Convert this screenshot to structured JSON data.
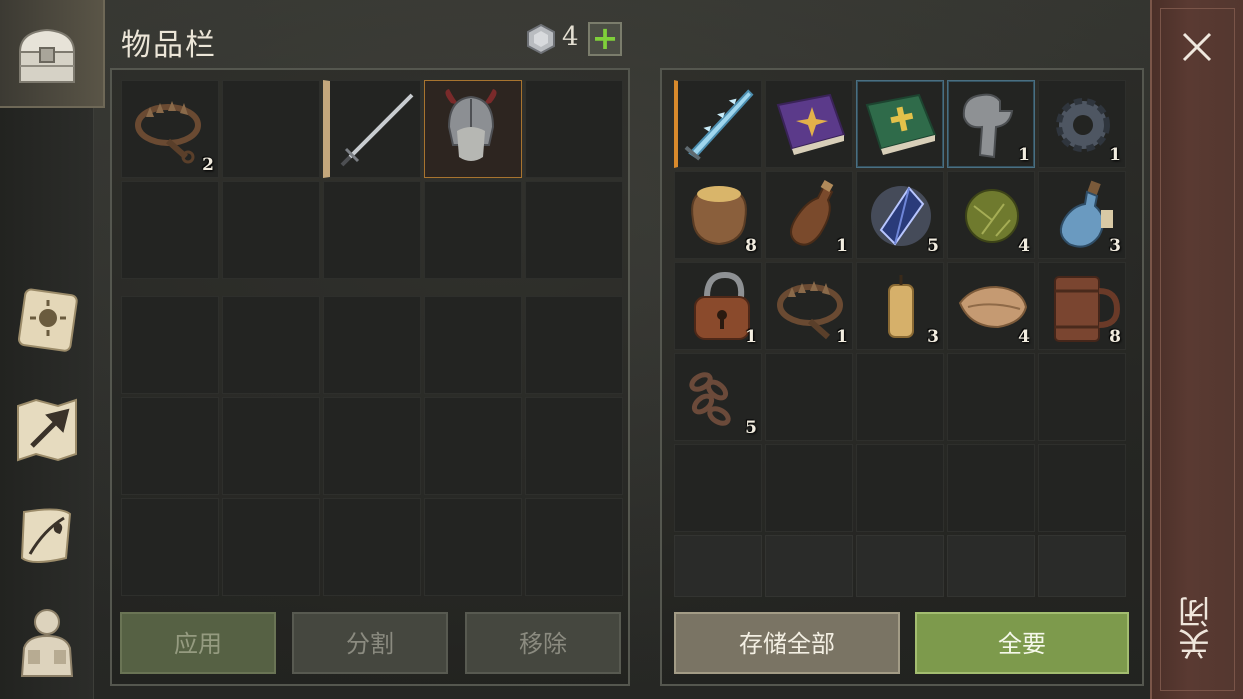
{
  "header": {
    "title": "物品栏",
    "currency_count": "4",
    "currency_icon": "gem-icon",
    "plus_label": "+"
  },
  "left_nav": [
    {
      "name": "chest",
      "icon": "chest-icon",
      "active": true
    },
    {
      "name": "sun-card",
      "icon": "sun-card-icon"
    },
    {
      "name": "map",
      "icon": "map-arrow-icon"
    },
    {
      "name": "scroll",
      "icon": "scroll-quill-icon"
    },
    {
      "name": "character",
      "icon": "character-backpack-icon"
    }
  ],
  "player_inventory": {
    "equip_row": [
      {
        "item": "bear-trap",
        "count": "2"
      },
      {
        "item": "",
        "count": ""
      },
      {
        "item": "sword",
        "count": ""
      },
      {
        "item": "horned-helmet",
        "count": ""
      },
      {
        "item": "",
        "count": ""
      }
    ]
  },
  "storage": {
    "items": [
      {
        "item": "ice-sword",
        "count": ""
      },
      {
        "item": "purple-book",
        "count": ""
      },
      {
        "item": "green-book",
        "count": ""
      },
      {
        "item": "wrench",
        "count": "1"
      },
      {
        "item": "gear",
        "count": "1"
      },
      {
        "item": "grain-sack",
        "count": "8"
      },
      {
        "item": "leather-bottle",
        "count": "1"
      },
      {
        "item": "crystal",
        "count": "5"
      },
      {
        "item": "herb-ball",
        "count": "4"
      },
      {
        "item": "potion",
        "count": "3"
      },
      {
        "item": "padlock",
        "count": "1"
      },
      {
        "item": "bear-trap",
        "count": "1"
      },
      {
        "item": "candle",
        "count": "3"
      },
      {
        "item": "cloth",
        "count": "4"
      },
      {
        "item": "tankard",
        "count": "8"
      },
      {
        "item": "chain",
        "count": "5"
      }
    ]
  },
  "buttons": {
    "apply": "应用",
    "split": "分割",
    "remove": "移除",
    "store_all": "存储全部",
    "take_all": "全要"
  },
  "close": {
    "label": "关闭",
    "icon": "close-icon"
  },
  "colors": {
    "accent_green": "#7d9a4c",
    "close_bar": "#5a3a32",
    "rare_border": "#4a6f82",
    "orange_quality": "#d98a2c"
  }
}
